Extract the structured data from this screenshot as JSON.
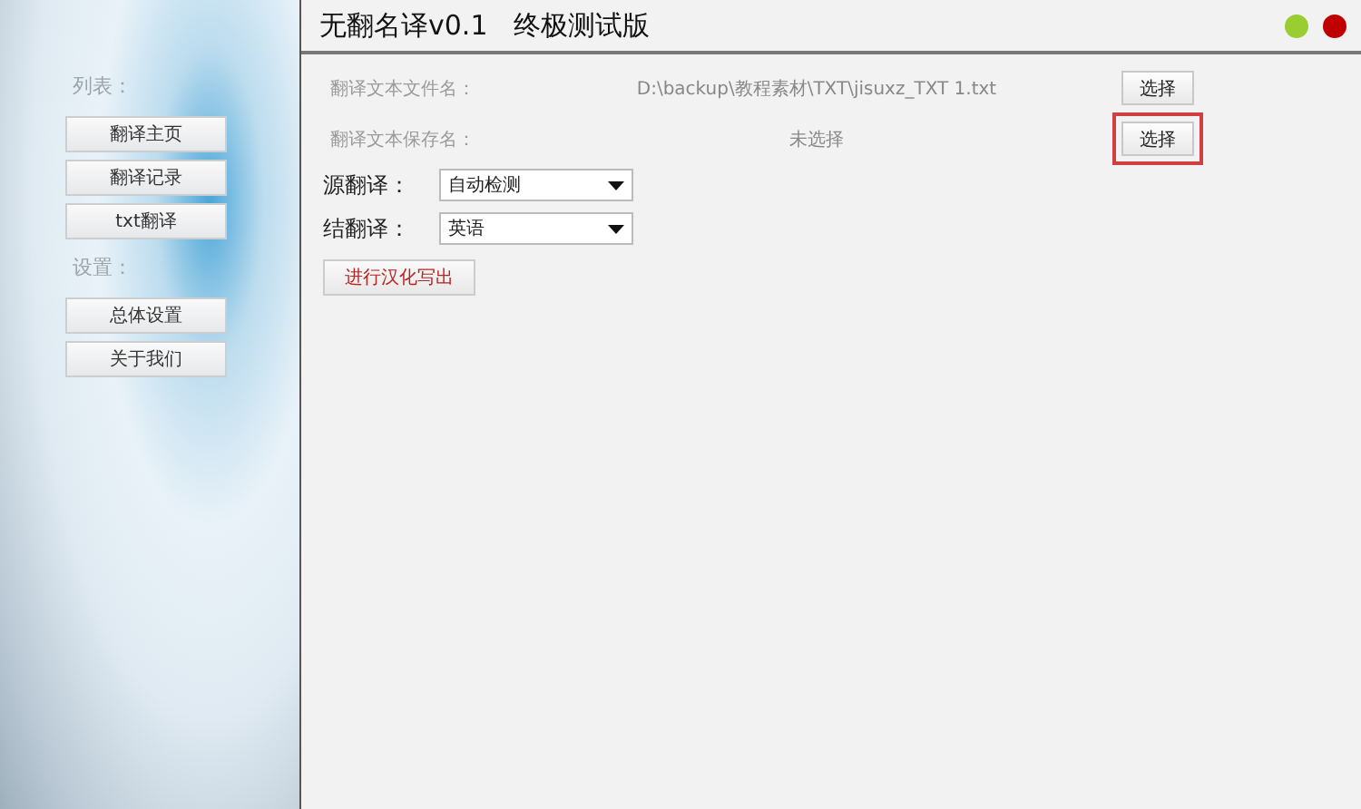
{
  "window": {
    "title": "无翻名译v0.1   终极测试版",
    "controls": [
      {
        "color": "#9acd32"
      },
      {
        "color": "#c00000"
      }
    ]
  },
  "sidebar": {
    "sections": [
      {
        "heading": "列表：",
        "items": [
          "翻译主页",
          "翻译记录",
          "txt翻译"
        ]
      },
      {
        "heading": "设置：",
        "items": [
          "总体设置",
          "关于我们"
        ]
      }
    ]
  },
  "files": [
    {
      "label": "翻译文本文件名：",
      "value": "D:\\backup\\教程素材\\TXT\\jisuxz_TXT 1.txt",
      "button": "选择",
      "highlighted": false
    },
    {
      "label": "翻译文本保存名：",
      "value": "未选择",
      "button": "选择",
      "highlighted": true
    }
  ],
  "selects": [
    {
      "label": "源翻译：",
      "value": "自动检测"
    },
    {
      "label": "结翻译：",
      "value": "英语"
    }
  ],
  "action_button": "进行汉化写出"
}
